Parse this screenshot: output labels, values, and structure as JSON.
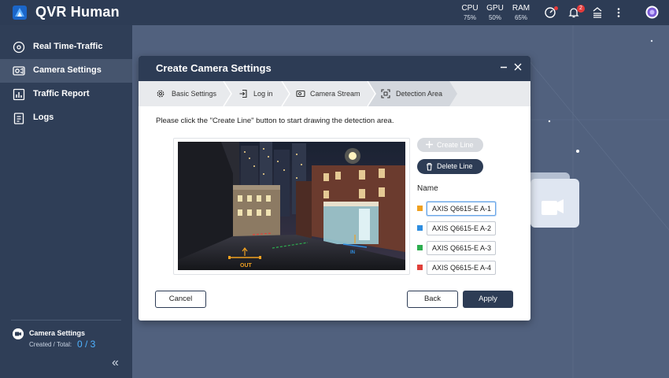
{
  "app": {
    "title": "QVR Human",
    "stats": [
      {
        "key": "CPU",
        "value": "75%"
      },
      {
        "key": "GPU",
        "value": "50%"
      },
      {
        "key": "RAM",
        "value": "65%"
      }
    ],
    "notification_count": "2",
    "icons": [
      "speedometer-icon",
      "bell-icon",
      "download-queue-icon",
      "more-vert-icon",
      "user-avatar-icon"
    ]
  },
  "sidebar": {
    "items": [
      {
        "label": "Real Time-Traffic",
        "icon": "disc-icon"
      },
      {
        "label": "Camera Settings",
        "icon": "camera-icon",
        "active": true
      },
      {
        "label": "Traffic Report",
        "icon": "bar-chart-icon"
      },
      {
        "label": "Logs",
        "icon": "clipboard-icon"
      }
    ],
    "footer": {
      "title": "Camera Settings",
      "subtitle": "Created / Total:",
      "count": "0 / 3"
    }
  },
  "modal": {
    "title": "Create Camera Settings",
    "steps": [
      {
        "label": "Basic Settings",
        "icon": "gear-icon"
      },
      {
        "label": "Log in",
        "icon": "login-icon"
      },
      {
        "label": "Camera Stream",
        "icon": "camera-icon"
      },
      {
        "label": "Detection Area",
        "icon": "focus-icon",
        "active": true
      }
    ],
    "instruction": "Please click the \"Create Line\" button to start drawing the detection area.",
    "preview": {
      "in_label": "IN",
      "out_label": "OUT"
    },
    "create_line_label": "Create Line",
    "delete_line_label": "Delete Line",
    "name_label": "Name",
    "lines": [
      {
        "name": "AXIS Q6615-E A-1",
        "color": "#f0a020"
      },
      {
        "name": "AXIS Q6615-E A-2",
        "color": "#2f8ee0"
      },
      {
        "name": "AXIS Q6615-E A-3",
        "color": "#2dae4f"
      },
      {
        "name": "AXIS Q6615-E A-4",
        "color": "#e0403a"
      }
    ],
    "cancel_label": "Cancel",
    "back_label": "Back",
    "apply_label": "Apply"
  }
}
